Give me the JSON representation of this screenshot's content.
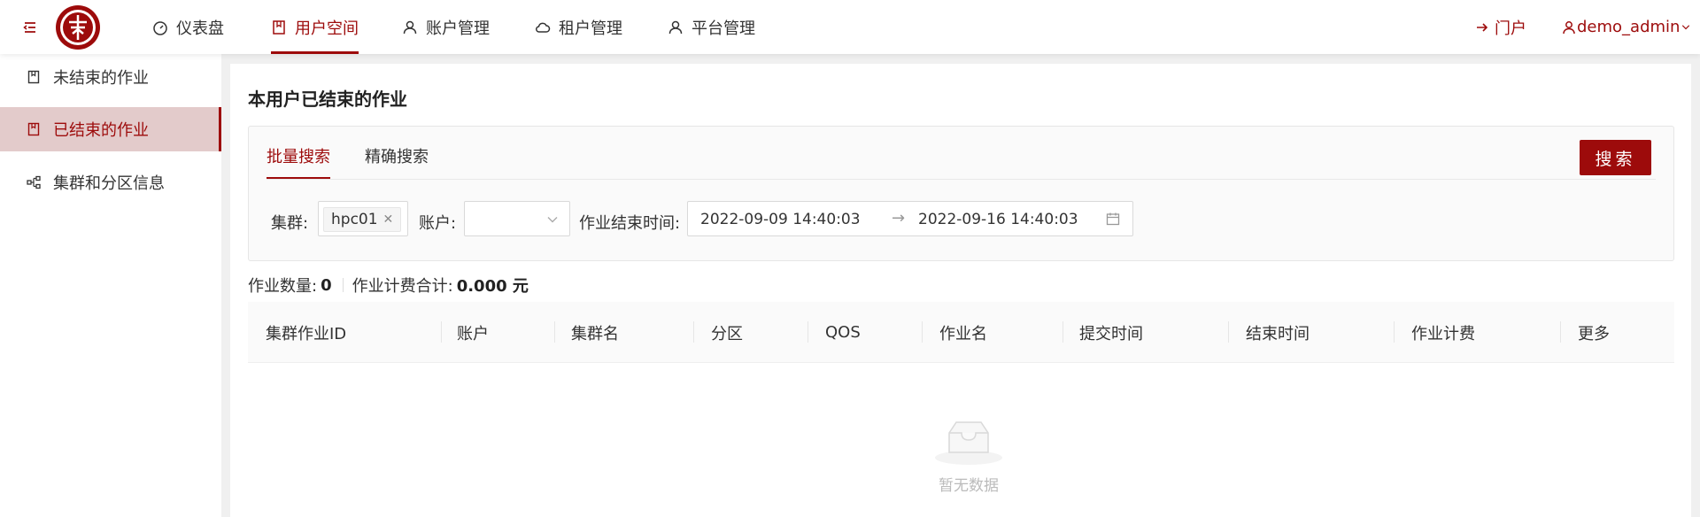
{
  "header": {
    "nav": [
      {
        "label": "仪表盘",
        "icon": "dashboard-icon"
      },
      {
        "label": "用户空间",
        "icon": "book-icon",
        "active": true
      },
      {
        "label": "账户管理",
        "icon": "user-icon"
      },
      {
        "label": "租户管理",
        "icon": "cloud-icon"
      },
      {
        "label": "平台管理",
        "icon": "user-icon"
      }
    ],
    "portal_label": "门户",
    "username": "demo_admin"
  },
  "sidebar": {
    "items": [
      {
        "label": "未结束的作业",
        "icon": "book-icon"
      },
      {
        "label": "已结束的作业",
        "icon": "book-icon",
        "active": true
      },
      {
        "label": "集群和分区信息",
        "icon": "cluster-icon"
      }
    ]
  },
  "main": {
    "title": "本用户已结束的作业",
    "tabs": [
      {
        "label": "批量搜索",
        "active": true
      },
      {
        "label": "精确搜索"
      }
    ],
    "search_label": "搜索",
    "filters": {
      "cluster_label": "集群:",
      "cluster_chip": "hpc01",
      "account_label": "账户:",
      "account_value": "",
      "end_time_label": "作业结束时间:",
      "start_date": "2022-09-09 14:40:03",
      "end_date": "2022-09-16 14:40:03"
    },
    "summary": {
      "count_label": "作业数量:",
      "count_value": "0",
      "fee_label": "作业计费合计:",
      "fee_value": "0.000 元"
    },
    "table": {
      "columns": [
        "集群作业ID",
        "账户",
        "集群名",
        "分区",
        "QOS",
        "作业名",
        "提交时间",
        "结束时间",
        "作业计费",
        "更多"
      ],
      "rows": [],
      "empty_text": "暂无数据"
    }
  },
  "colors": {
    "accent": "#9d0b0b",
    "active_bg": "#e3cbcb"
  }
}
